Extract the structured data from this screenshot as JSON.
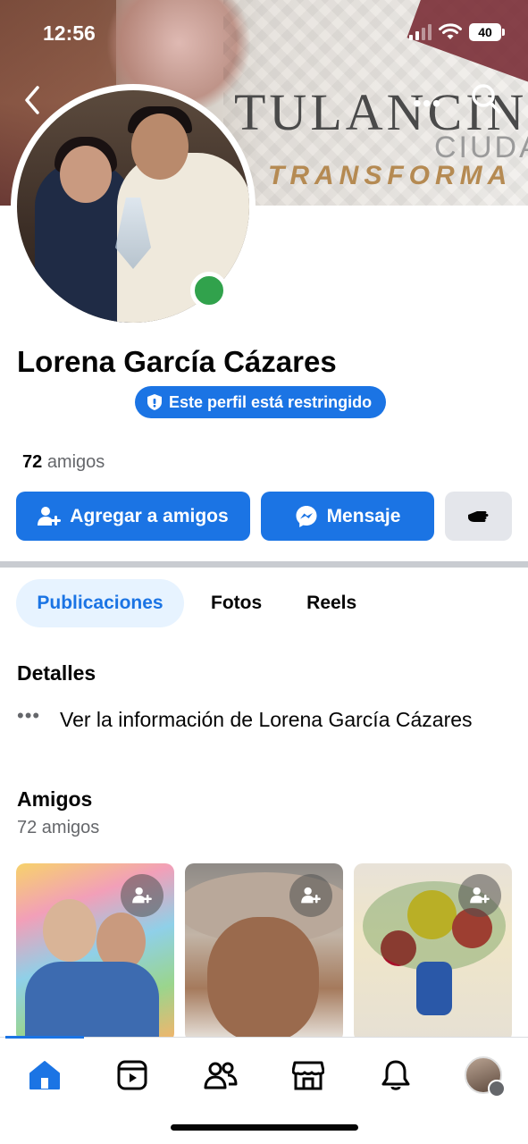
{
  "status_bar": {
    "time": "12:56",
    "battery": "40"
  },
  "cover": {
    "line1": "TULANCIN",
    "line2": "CIUDA",
    "line3": "TRANSFORMA"
  },
  "header": {
    "more": "•••"
  },
  "profile": {
    "name": "Lorena García Cázares",
    "restricted_badge": "Este perfil está restringido",
    "friends_count": "72",
    "friends_label": "amigos",
    "online_color": "#31a24c"
  },
  "actions": {
    "add_friend": "Agregar a amigos",
    "message": "Mensaje"
  },
  "tabs": [
    {
      "label": "Publicaciones",
      "active": true
    },
    {
      "label": "Fotos",
      "active": false
    },
    {
      "label": "Reels",
      "active": false
    }
  ],
  "details": {
    "title": "Detalles",
    "more": "•••",
    "info_text": "Ver la información de Lorena García Cázares"
  },
  "friends": {
    "title": "Amigos",
    "subtitle": "72 amigos"
  },
  "colors": {
    "accent": "#1b74e4",
    "tab_active_bg": "#e7f3ff",
    "button_gray": "#e4e6eb"
  },
  "bottom_nav": [
    "home-icon",
    "reels-icon",
    "friends-icon",
    "marketplace-icon",
    "notifications-icon",
    "profile-avatar"
  ]
}
